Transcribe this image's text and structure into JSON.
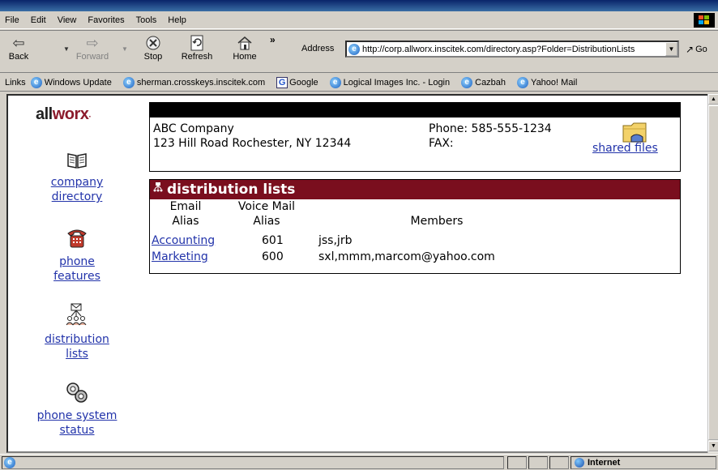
{
  "menu": [
    "File",
    "Edit",
    "View",
    "Favorites",
    "Tools",
    "Help"
  ],
  "toolbar": {
    "back": "Back",
    "forward": "Forward",
    "stop": "Stop",
    "refresh": "Refresh",
    "home": "Home",
    "address_label": "Address",
    "url": "http://corp.allworx.inscitek.com/directory.asp?Folder=DistributionLists",
    "go": "Go"
  },
  "links": {
    "label": "Links",
    "items": [
      "Windows Update",
      "sherman.crosskeys.inscitek.com",
      "Google",
      "Logical Images Inc. - Login",
      "Cazbah",
      "Yahoo! Mail"
    ]
  },
  "sidebar": {
    "logo_main": "all",
    "logo_accent": "worx",
    "items": [
      {
        "line1": "company",
        "line2": "directory"
      },
      {
        "line1": "phone",
        "line2": "features"
      },
      {
        "line1": "distribution",
        "line2": "lists"
      },
      {
        "line1": "phone system",
        "line2": "status"
      }
    ]
  },
  "company": {
    "name": "ABC Company",
    "address": "123 Hill Road Rochester, NY 12344",
    "phone": "Phone: 585-555-1234",
    "fax": "FAX:",
    "shared_files": "shared files"
  },
  "distribution": {
    "title": "distribution lists",
    "headers": {
      "email_1": "Email",
      "email_2": "Alias",
      "voicemail_1": "Voice Mail",
      "voicemail_2": "Alias",
      "members": "Members"
    },
    "rows": [
      {
        "alias": "Accounting",
        "voicemail": "601",
        "members": "jss,jrb"
      },
      {
        "alias": "Marketing",
        "voicemail": "600",
        "members": "sxl,mmm,marcom@yahoo.com"
      }
    ]
  },
  "status": {
    "zone": "Internet"
  }
}
